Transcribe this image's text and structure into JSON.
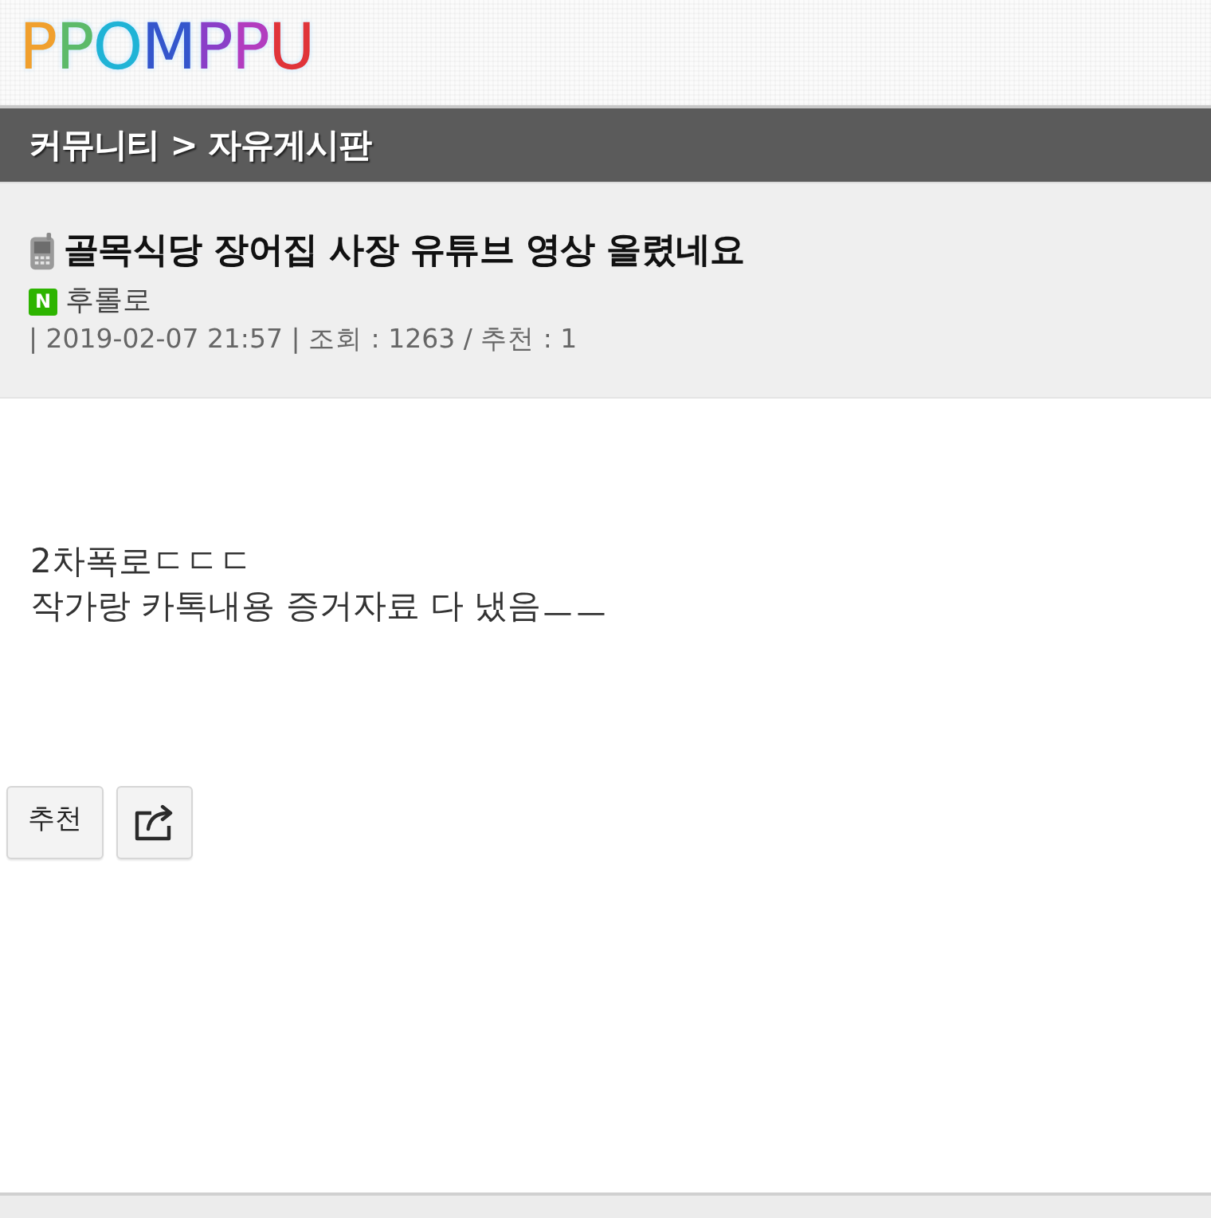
{
  "logo": {
    "text": "PPOMPPU"
  },
  "breadcrumb": {
    "text": "커뮤니티 > 자유게시판"
  },
  "post": {
    "title": "골목식당 장어집 사장 유튜브 영상 올렸네요",
    "badge": "N",
    "author": "후롤로",
    "meta": "| 2019-02-07 21:57 | 조회 : 1263 / 추천 : 1",
    "body": [
      "2차폭로ㄷㄷㄷ",
      "작가랑 카톡내용 증거자료 다 냈음ㅡㅡ"
    ]
  },
  "actions": [
    {
      "kind": "text",
      "label": "추천"
    },
    {
      "kind": "share"
    }
  ]
}
